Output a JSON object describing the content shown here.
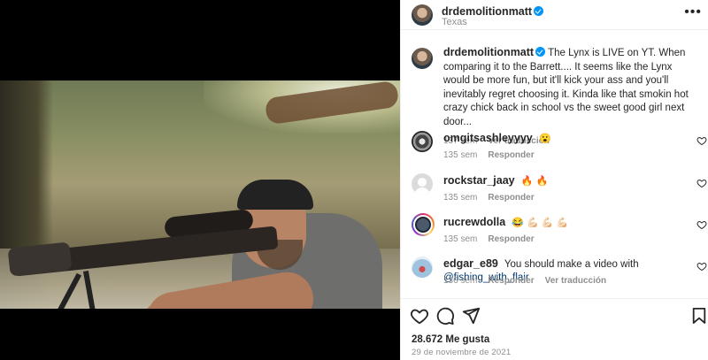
{
  "post": {
    "author": "drdemolitionmatt",
    "location": "Texas",
    "caption": "The Lynx is LIVE on YT. When comparing it to the Barrett.... It seems like the Lynx would be more fun, but it'll kick your ass and you'll inevitably regret choosing it. Kinda like that smokin hot crazy chick back in school vs the sweet good girl next door...",
    "caption_age": "137 sem",
    "caption_translate": "Ver traducción",
    "more_label": "•••"
  },
  "comments": [
    {
      "user": "omgitsashleyyyy",
      "text": "",
      "emoji": "😮",
      "age": "135 sem",
      "reply": "Responder",
      "translate": ""
    },
    {
      "user": "rockstar_jaay",
      "text": "",
      "emoji": "🔥 🔥",
      "age": "135 sem",
      "reply": "Responder",
      "translate": ""
    },
    {
      "user": "rucrewdolla",
      "text": "",
      "emoji": "😂 💪🏻 💪🏻 💪🏻",
      "age": "135 sem",
      "reply": "Responder",
      "translate": ""
    },
    {
      "user": "edgar_e89",
      "text": "You should make a video with",
      "mention": "@fishing_with_flair",
      "emoji": "",
      "age": "136 sem",
      "reply": "Responder",
      "translate": "Ver traducción"
    }
  ],
  "footer": {
    "likes": "28.672 Me gusta",
    "date": "29 de noviembre de 2021"
  },
  "icons": {
    "like": "heart-icon",
    "comment": "comment-icon",
    "share": "share-icon",
    "save": "bookmark-icon"
  }
}
